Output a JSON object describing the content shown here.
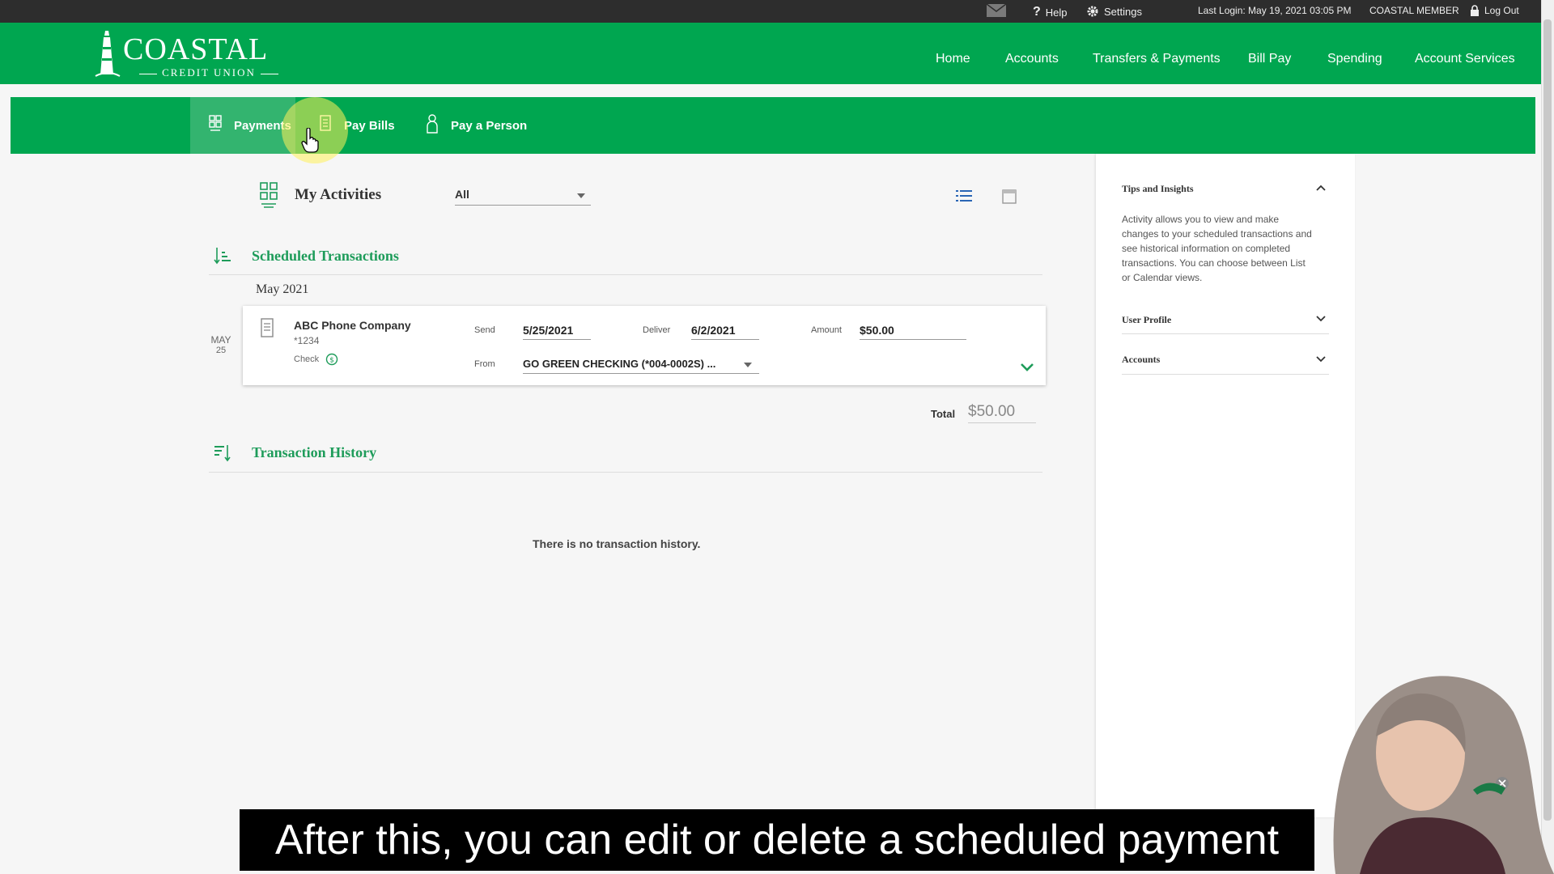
{
  "topbar": {
    "help": "Help",
    "settings": "Settings",
    "last_login": "Last Login: May 19, 2021 03:05 PM",
    "member": "COASTAL MEMBER",
    "logout": "Log Out"
  },
  "brand": {
    "name": "COASTAL",
    "sub": "CREDIT UNION",
    "color": "#00a650"
  },
  "nav": [
    "Home",
    "Accounts",
    "Transfers & Payments",
    "Bill Pay",
    "Spending",
    "Account Services"
  ],
  "subnav": {
    "payments": "Payments",
    "pay_bills": "Pay Bills",
    "pay_person": "Pay a Person"
  },
  "activity": {
    "title": "My Activities",
    "filter": "All"
  },
  "scheduled": {
    "title": "Scheduled Transactions",
    "month": "May 2021",
    "date_month": "MAY",
    "date_day": "25",
    "payee": "ABC Phone Company",
    "account_mask": "*1234",
    "method": "Check",
    "send_label": "Send",
    "send_date": "5/25/2021",
    "deliver_label": "Deliver",
    "deliver_date": "6/2/2021",
    "amount_label": "Amount",
    "amount": "$50.00",
    "from_label": "From",
    "from_account": "GO GREEN CHECKING (*004-0002S) ...",
    "total_label": "Total",
    "total": "$50.00"
  },
  "history": {
    "title": "Transaction History",
    "empty": "There is no transaction history."
  },
  "sidebar": {
    "tips_title": "Tips and Insights",
    "tips_text": "Activity allows you to view and make changes to your scheduled transactions and see historical information on completed transactions. You can choose between List or Calendar views.",
    "user_profile": "User Profile",
    "accounts": "Accounts"
  },
  "caption": "After this, you can edit or delete a scheduled payment"
}
